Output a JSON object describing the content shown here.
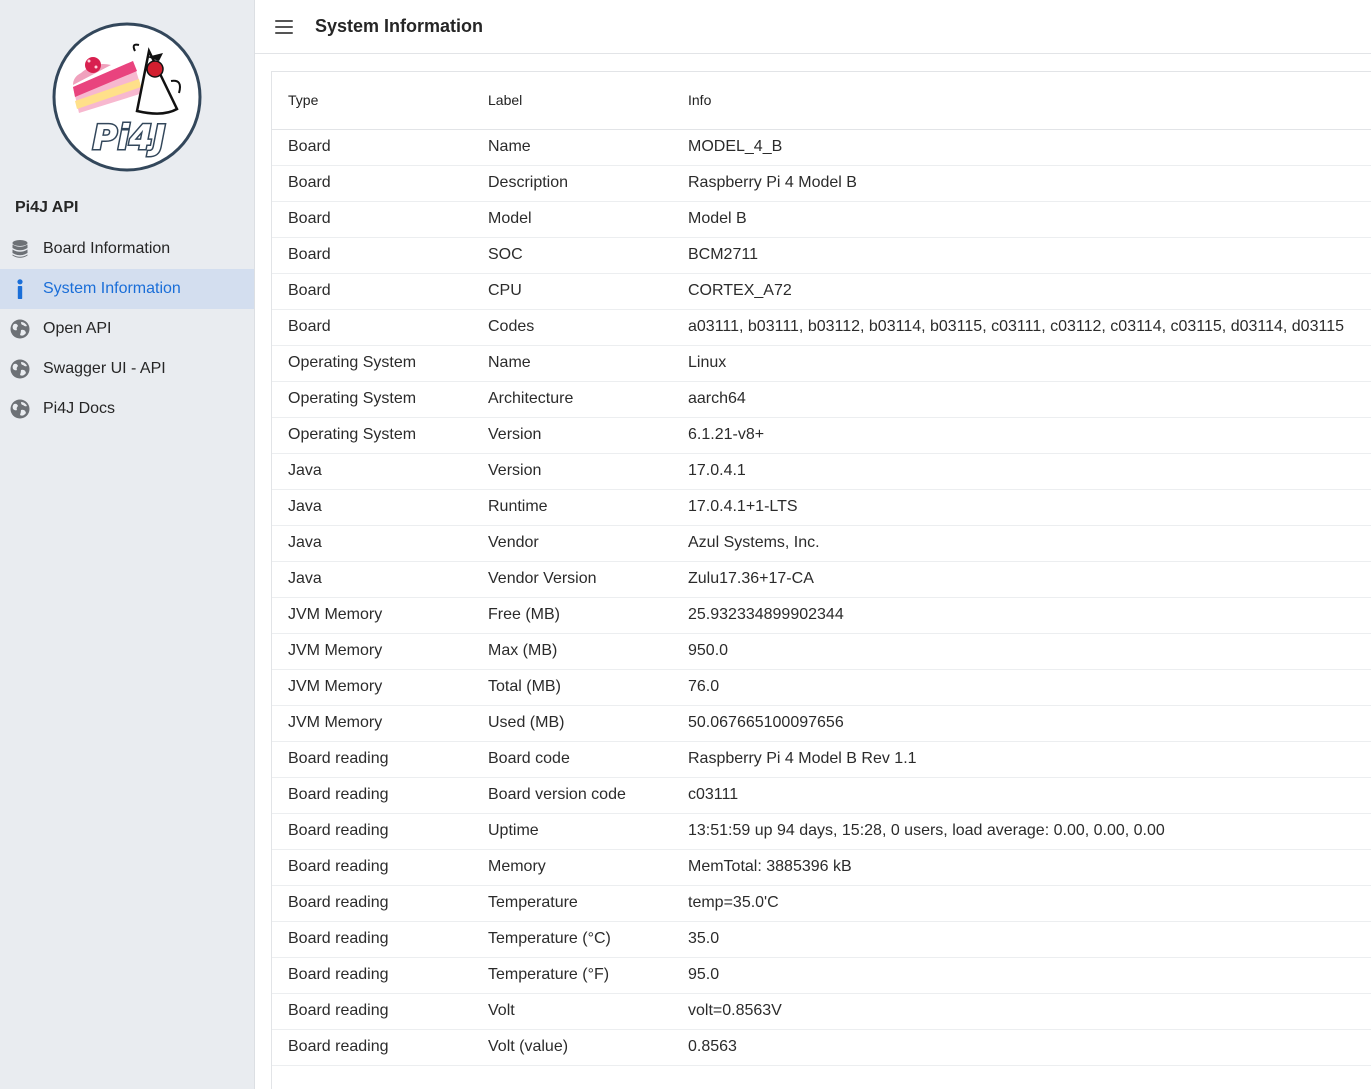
{
  "sidebar": {
    "logo_text": "Pi4J",
    "app_title": "Pi4J API",
    "items": [
      {
        "label": "Board Information",
        "icon": "database-icon",
        "active": false
      },
      {
        "label": "System Information",
        "icon": "info-icon",
        "active": true
      },
      {
        "label": "Open API",
        "icon": "globe-icon",
        "active": false
      },
      {
        "label": "Swagger UI - API",
        "icon": "globe-icon",
        "active": false
      },
      {
        "label": "Pi4J Docs",
        "icon": "globe-icon",
        "active": false
      }
    ]
  },
  "header": {
    "title": "System Information"
  },
  "table": {
    "columns": [
      "Type",
      "Label",
      "Info"
    ],
    "rows": [
      [
        "Board",
        "Name",
        "MODEL_4_B"
      ],
      [
        "Board",
        "Description",
        "Raspberry Pi 4 Model B"
      ],
      [
        "Board",
        "Model",
        "Model B"
      ],
      [
        "Board",
        "SOC",
        "BCM2711"
      ],
      [
        "Board",
        "CPU",
        "CORTEX_A72"
      ],
      [
        "Board",
        "Codes",
        "a03111, b03111, b03112, b03114, b03115, c03111, c03112, c03114, c03115, d03114, d03115"
      ],
      [
        "Operating System",
        "Name",
        "Linux"
      ],
      [
        "Operating System",
        "Architecture",
        "aarch64"
      ],
      [
        "Operating System",
        "Version",
        "6.1.21-v8+"
      ],
      [
        "Java",
        "Version",
        "17.0.4.1"
      ],
      [
        "Java",
        "Runtime",
        "17.0.4.1+1-LTS"
      ],
      [
        "Java",
        "Vendor",
        "Azul Systems, Inc."
      ],
      [
        "Java",
        "Vendor Version",
        "Zulu17.36+17-CA"
      ],
      [
        "JVM Memory",
        "Free (MB)",
        "25.932334899902344"
      ],
      [
        "JVM Memory",
        "Max (MB)",
        "950.0"
      ],
      [
        "JVM Memory",
        "Total (MB)",
        "76.0"
      ],
      [
        "JVM Memory",
        "Used (MB)",
        "50.067665100097656"
      ],
      [
        "Board reading",
        "Board code",
        "Raspberry Pi 4 Model B Rev 1.1"
      ],
      [
        "Board reading",
        "Board version code",
        "c03111"
      ],
      [
        "Board reading",
        "Uptime",
        "13:51:59 up 94 days, 15:28, 0 users, load average: 0.00, 0.00, 0.00"
      ],
      [
        "Board reading",
        "Memory",
        "MemTotal: 3885396 kB"
      ],
      [
        "Board reading",
        "Temperature",
        "temp=35.0'C"
      ],
      [
        "Board reading",
        "Temperature (°C)",
        "35.0"
      ],
      [
        "Board reading",
        "Temperature (°F)",
        "95.0"
      ],
      [
        "Board reading",
        "Volt",
        "volt=0.8563V"
      ],
      [
        "Board reading",
        "Volt (value)",
        "0.8563"
      ]
    ]
  },
  "colors": {
    "accent": "#1a6ed8",
    "active_bg": "#d3deef",
    "sidebar_bg": "#e9ecf0"
  }
}
